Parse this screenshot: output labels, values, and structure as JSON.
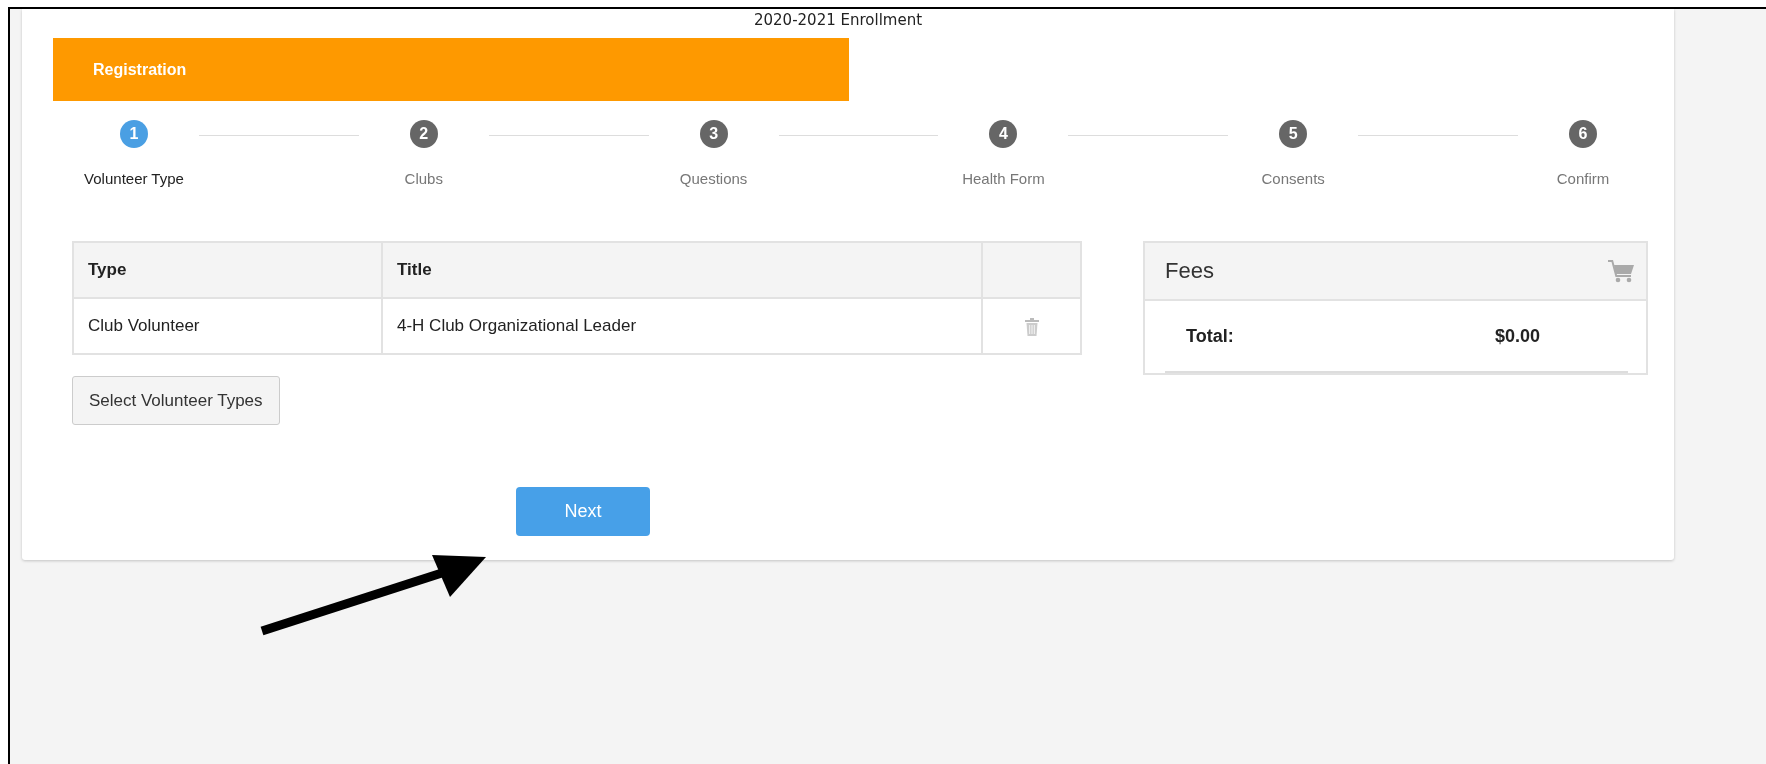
{
  "page_title": "2020-2021 Enrollment",
  "section_header": "Registration",
  "steps": [
    {
      "number": "1",
      "label": "Volunteer Type",
      "selected": true
    },
    {
      "number": "2",
      "label": "Clubs",
      "selected": false
    },
    {
      "number": "3",
      "label": "Questions",
      "selected": false
    },
    {
      "number": "4",
      "label": "Health Form",
      "selected": false
    },
    {
      "number": "5",
      "label": "Consents",
      "selected": false
    },
    {
      "number": "6",
      "label": "Confirm",
      "selected": false
    }
  ],
  "table": {
    "columns": [
      "Type",
      "Title"
    ],
    "rows": [
      {
        "type": "Club Volunteer",
        "title": "4-H Club Organizational Leader"
      }
    ]
  },
  "select_button": "Select Volunteer Types",
  "fees": {
    "title": "Fees",
    "total_label": "Total:",
    "total_value": "$0.00"
  },
  "next_button": "Next"
}
